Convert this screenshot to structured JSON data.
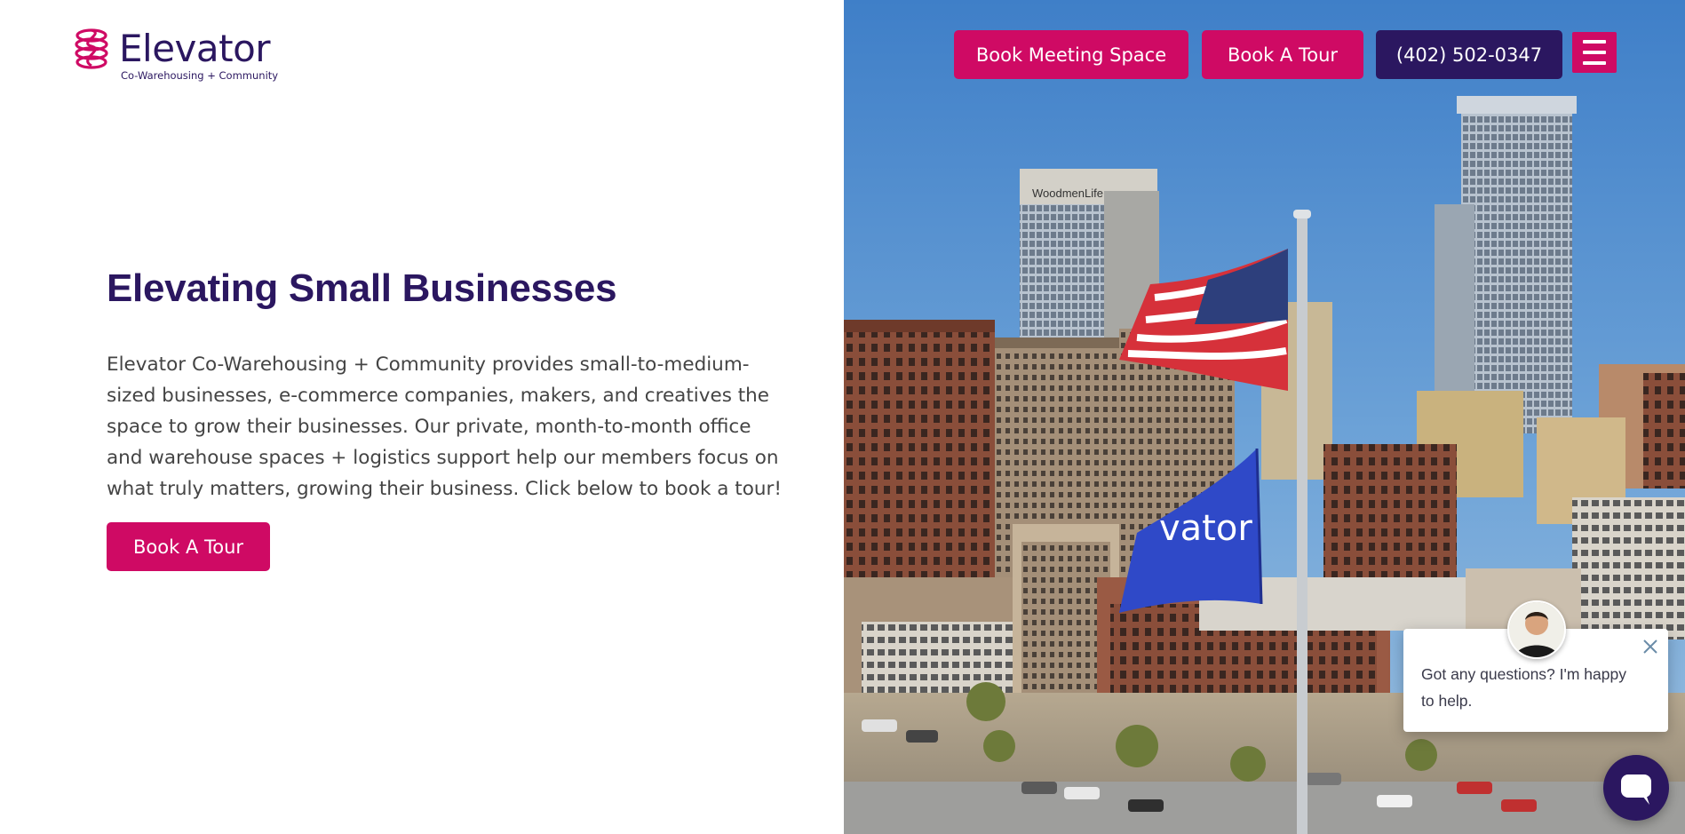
{
  "brand": {
    "name": "Elevator",
    "tagline": "Co-Warehousing + Community",
    "colors": {
      "primary": "#cf0a64",
      "secondary": "#2b1760"
    }
  },
  "nav": {
    "book_meeting_label": "Book Meeting Space",
    "book_tour_label": "Book A Tour",
    "phone_label": "(402) 502-0347",
    "menu_icon": "hamburger-icon"
  },
  "hero": {
    "title": "Elevating Small Businesses",
    "body": "Elevator Co-Warehousing + Community provides small-to-medium-sized businesses, e-commerce companies, makers, and creatives the space to grow their businesses. Our private, month-to-month office and warehouse spaces + logistics support help our members focus on what truly matters, growing their business. Click below to book a tour!",
    "cta_label": "Book A Tour"
  },
  "scene": {
    "tower_sign": "WoodmenLife",
    "flag_text": "vator"
  },
  "chat": {
    "message": "Got any questions? I'm happy to help.",
    "close_icon": "close-icon",
    "launcher_icon": "chat-bubble-icon"
  }
}
